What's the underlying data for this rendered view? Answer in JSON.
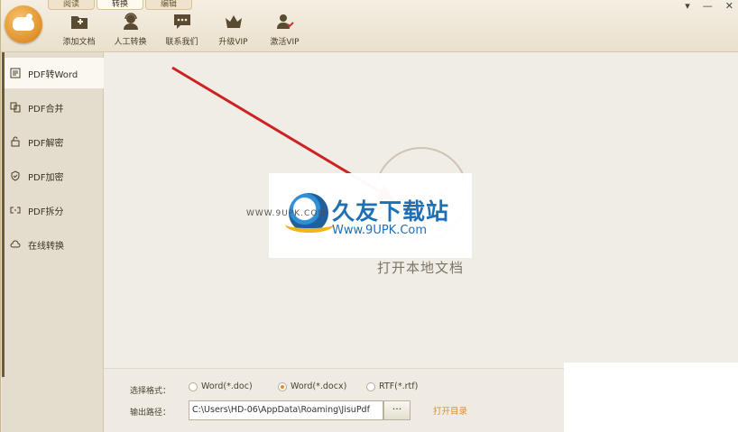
{
  "tabs": [
    "阅读",
    "转换",
    "编辑"
  ],
  "active_tab": 1,
  "toolbar": [
    {
      "label": "添加文档",
      "icon": "add-document-icon"
    },
    {
      "label": "人工转换",
      "icon": "agent-icon"
    },
    {
      "label": "联系我们",
      "icon": "chat-icon"
    },
    {
      "label": "升级VIP",
      "icon": "crown-icon"
    },
    {
      "label": "激活VIP",
      "icon": "user-check-icon"
    }
  ],
  "window_controls": [
    "▾",
    "—",
    "✕"
  ],
  "sidebar": {
    "items": [
      {
        "label": "PDF转Word",
        "icon": "word-doc-icon",
        "active": true
      },
      {
        "label": "PDF合并",
        "icon": "merge-icon"
      },
      {
        "label": "PDF解密",
        "icon": "unlock-icon"
      },
      {
        "label": "PDF加密",
        "icon": "shield-icon"
      },
      {
        "label": "PDF拆分",
        "icon": "split-icon"
      },
      {
        "label": "在线转换",
        "icon": "cloud-icon"
      }
    ]
  },
  "main": {
    "open_label": "打开本地文档"
  },
  "bottom": {
    "format_label": "选择格式：",
    "formats": [
      {
        "label": "Word(*.doc)",
        "selected": false
      },
      {
        "label": "Word(*.docx)",
        "selected": true
      },
      {
        "label": "RTF(*.rtf)",
        "selected": false
      }
    ],
    "output_label": "输出路径：",
    "output_path": "C:\\Users\\HD-06\\AppData\\Roaming\\JisuPdf",
    "browse_label": "···",
    "open_dir_label": "打开目录"
  },
  "watermark": {
    "site_name": "久友下载站",
    "url": "Www.9UPK.Com",
    "small": "WWW.9UPK.COM"
  },
  "colors": {
    "accent": "#e08a28",
    "arrow": "#cc2222"
  }
}
